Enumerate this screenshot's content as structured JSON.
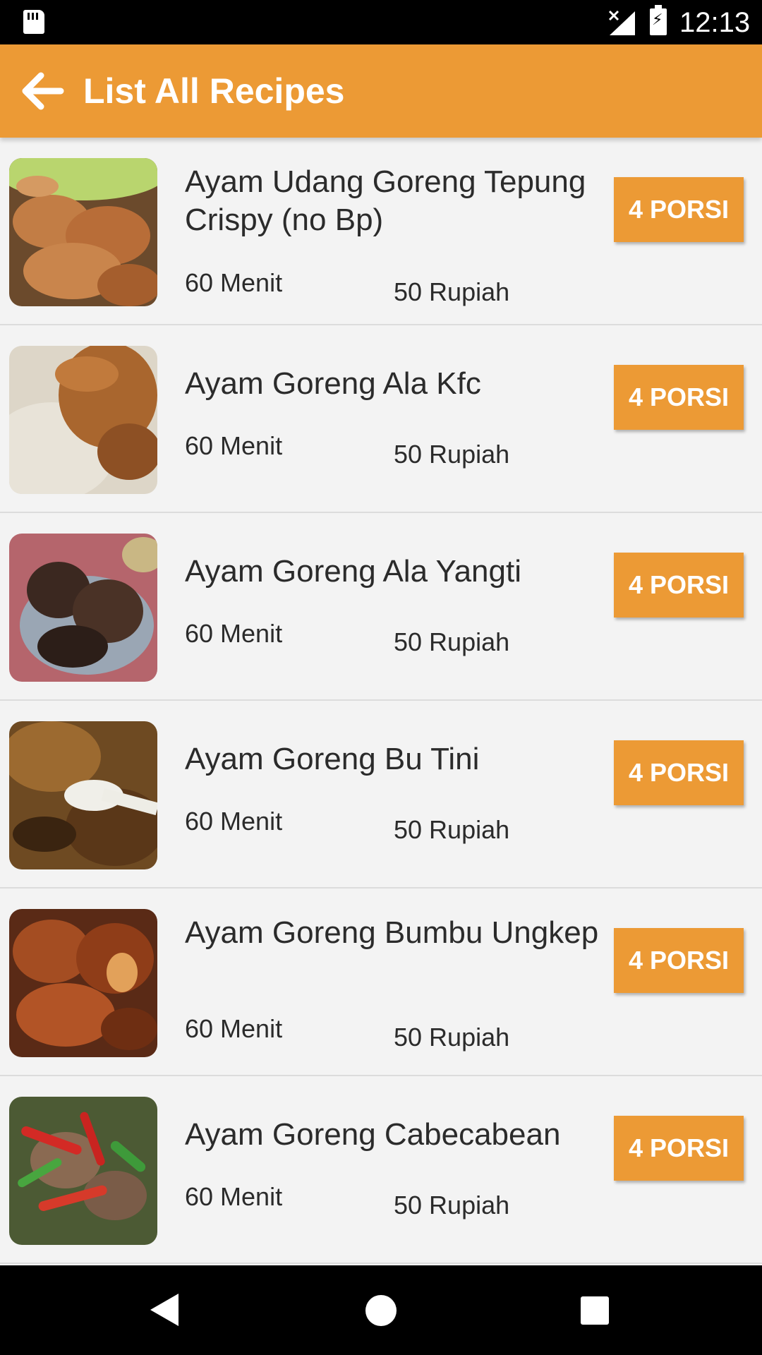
{
  "status_bar": {
    "time": "12:13"
  },
  "app_bar": {
    "title": "List All Recipes"
  },
  "recipes": [
    {
      "title": "Ayam  Udang Goreng Tepung Crispy (no Bp)",
      "time": "60 Menit",
      "price": "50 Rupiah",
      "portion": "4 PORSI"
    },
    {
      "title": "Ayam Goreng Ala Kfc",
      "time": "60 Menit",
      "price": "50 Rupiah",
      "portion": "4 PORSI"
    },
    {
      "title": "Ayam Goreng Ala Yangti",
      "time": "60 Menit",
      "price": "50 Rupiah",
      "portion": "4 PORSI"
    },
    {
      "title": "Ayam Goreng Bu Tini",
      "time": "60 Menit",
      "price": "50 Rupiah",
      "portion": "4 PORSI"
    },
    {
      "title": "Ayam Goreng Bumbu Ungkep",
      "time": "60 Menit",
      "price": "50 Rupiah",
      "portion": "4 PORSI"
    },
    {
      "title": "Ayam Goreng Cabecabean",
      "time": "60 Menit",
      "price": "50 Rupiah",
      "portion": "4 PORSI"
    }
  ],
  "colors": {
    "accent": "#ec9a35",
    "background": "#f3f3f3",
    "text": "#2b2b2b"
  }
}
